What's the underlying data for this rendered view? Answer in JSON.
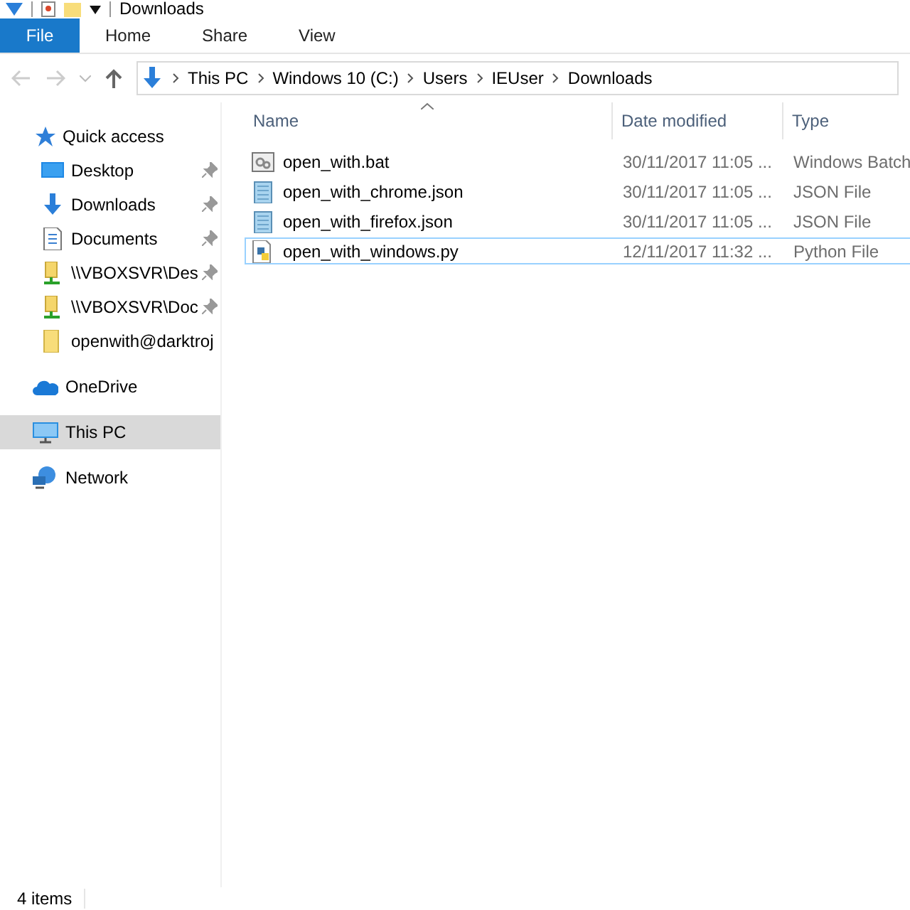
{
  "window": {
    "title": "Downloads"
  },
  "ribbon_tabs": [
    {
      "label": "File",
      "kind": "file",
      "selected": false
    },
    {
      "label": "Home",
      "kind": "tab",
      "selected": false
    },
    {
      "label": "Share",
      "kind": "tab",
      "selected": false
    },
    {
      "label": "View",
      "kind": "tab",
      "selected": false
    }
  ],
  "navigation": {
    "back_disabled": true,
    "forward_disabled": true
  },
  "breadcrumb": [
    "This PC",
    "Windows 10 (C:)",
    "Users",
    "IEUser",
    "Downloads"
  ],
  "sidebar": {
    "items": [
      {
        "label": "Quick access",
        "kind": "star",
        "selected": false,
        "children": [
          {
            "label": "Desktop",
            "kind": "desktop",
            "pinned": true,
            "selected": false
          },
          {
            "label": "Downloads",
            "kind": "download",
            "pinned": true,
            "selected": false
          },
          {
            "label": "Documents",
            "kind": "document",
            "pinned": true,
            "selected": false
          },
          {
            "label": "\\\\VBOXSVR\\Des",
            "kind": "share",
            "pinned": true,
            "selected": false
          },
          {
            "label": "\\\\VBOXSVR\\Doc",
            "kind": "share",
            "pinned": true,
            "selected": false
          },
          {
            "label": "openwith@darktroj",
            "kind": "folder",
            "pinned": false,
            "selected": false
          }
        ]
      },
      {
        "label": "OneDrive",
        "kind": "cloud",
        "selected": false
      },
      {
        "label": "This PC",
        "kind": "pc",
        "selected": true
      },
      {
        "label": "Network",
        "kind": "network",
        "selected": false
      }
    ]
  },
  "file_list": {
    "columns": [
      "Name",
      "Date modified",
      "Type"
    ],
    "rows": [
      {
        "name": "open_with.bat",
        "kind": "bat",
        "date": "30/11/2017 11:05 ...",
        "type": "Windows Batch",
        "selected": false
      },
      {
        "name": "open_with_chrome.json",
        "kind": "text",
        "date": "30/11/2017 11:05 ...",
        "type": "JSON File",
        "selected": false
      },
      {
        "name": "open_with_firefox.json",
        "kind": "text",
        "date": "30/11/2017 11:05 ...",
        "type": "JSON File",
        "selected": false
      },
      {
        "name": "open_with_windows.py",
        "kind": "python",
        "date": "12/11/2017 11:32 ...",
        "type": "Python File",
        "selected": true
      }
    ]
  },
  "status_bar": {
    "text": "4 items"
  }
}
